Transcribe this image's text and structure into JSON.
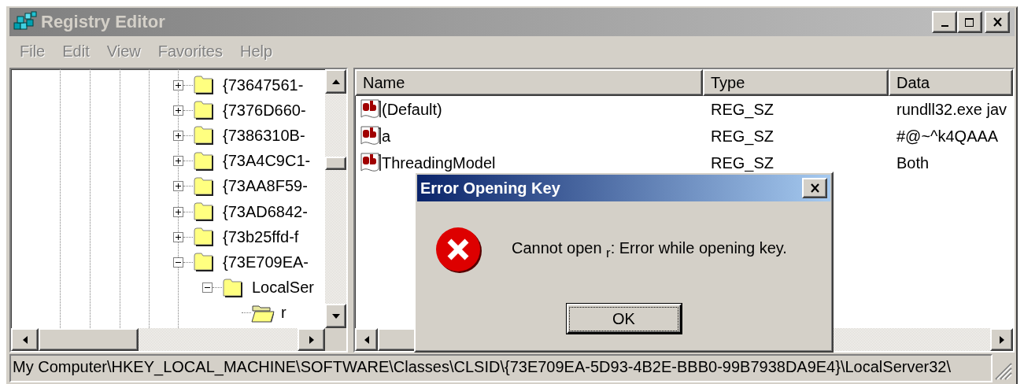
{
  "window": {
    "title": "Registry Editor",
    "active": false
  },
  "menu": [
    {
      "label": "File",
      "disabled": true
    },
    {
      "label": "Edit",
      "disabled": true
    },
    {
      "label": "View",
      "disabled": true
    },
    {
      "label": "Favorites",
      "disabled": true
    },
    {
      "label": "Help",
      "disabled": true
    }
  ],
  "tree": {
    "items": [
      {
        "label": "{73647561-",
        "expanded": false,
        "selected": false
      },
      {
        "label": "{7376D660-",
        "expanded": false,
        "selected": false
      },
      {
        "label": "{7386310B-",
        "expanded": false,
        "selected": false
      },
      {
        "label": "{73A4C9C1-",
        "expanded": false,
        "selected": false
      },
      {
        "label": "{73AA8F59-",
        "expanded": false,
        "selected": false
      },
      {
        "label": "{73AD6842-",
        "expanded": false,
        "selected": false
      },
      {
        "label": "{73b25ffd-f",
        "expanded": false,
        "selected": false
      },
      {
        "label": "{73E709EA-",
        "expanded": true,
        "selected": false,
        "children": [
          {
            "label": "LocalSer",
            "expanded": true,
            "selected": false,
            "children": [
              {
                "label": "r",
                "selected": true
              }
            ]
          }
        ]
      }
    ]
  },
  "values": {
    "columns": [
      "Name",
      "Type",
      "Data"
    ],
    "rows": [
      {
        "name": "(Default)",
        "type": "REG_SZ",
        "data": "rundll32.exe jav"
      },
      {
        "name": "a",
        "type": "REG_SZ",
        "data": "#@~^k4QAAA"
      },
      {
        "name": "ThreadingModel",
        "type": "REG_SZ",
        "data": "Both"
      }
    ]
  },
  "dialog": {
    "title": "Error Opening Key",
    "active": true,
    "message": "Cannot open $_{r}$: Error while opening key.",
    "buttons": [
      {
        "label": "OK",
        "focused": true
      }
    ]
  },
  "status_bar": "My Computer\\HKEY_LOCAL_MACHINE\\SOFTWARE\\Classes\\CLSID\\{73E709EA-5D93-4B2E-BBB0-99B7938DA9E4}\\LocalServer32\\"
}
